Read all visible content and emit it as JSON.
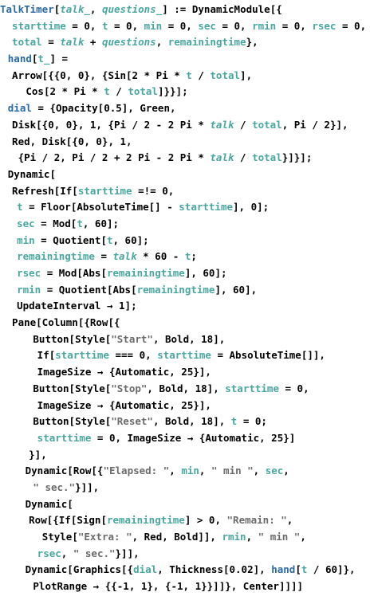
{
  "document": {
    "title": "TalkTimer notebook input",
    "lines": [
      {
        "indent": 0,
        "tokens": [
          [
            "f",
            "TalkTimer"
          ],
          [
            "p",
            "["
          ],
          [
            "i",
            "talk_"
          ],
          [
            "p",
            ", "
          ],
          [
            "i",
            "questions_"
          ],
          [
            "p",
            "] := DynamicModule[{"
          ]
        ]
      },
      {
        "indent": 2,
        "tokens": [
          [
            "g",
            "starttime"
          ],
          [
            "p",
            " = 0, "
          ],
          [
            "g",
            "t"
          ],
          [
            "p",
            " = 0, "
          ],
          [
            "g",
            "min"
          ],
          [
            "p",
            " = 0, "
          ],
          [
            "g",
            "sec"
          ],
          [
            "p",
            " = 0, "
          ],
          [
            "g",
            "rmin"
          ],
          [
            "p",
            " = 0, "
          ],
          [
            "g",
            "rsec"
          ],
          [
            "p",
            " = 0,"
          ]
        ]
      },
      {
        "indent": 2,
        "tokens": [
          [
            "g",
            "total"
          ],
          [
            "p",
            " = "
          ],
          [
            "i",
            "talk"
          ],
          [
            "p",
            " + "
          ],
          [
            "i",
            "questions"
          ],
          [
            "p",
            ", "
          ],
          [
            "g",
            "remainingtime"
          ],
          [
            "p",
            "},"
          ]
        ]
      },
      {
        "indent": 1.3,
        "tokens": [
          [
            "f",
            "hand"
          ],
          [
            "p",
            "["
          ],
          [
            "g",
            "t_"
          ],
          [
            "p",
            "] ="
          ]
        ]
      },
      {
        "indent": 2,
        "tokens": [
          [
            "p",
            "Arrow[{{0, 0}, {Sin[2 * Pi * "
          ],
          [
            "g",
            "t"
          ],
          [
            "p",
            " / "
          ],
          [
            "g",
            "total"
          ],
          [
            "p",
            "],"
          ]
        ]
      },
      {
        "indent": 4.3,
        "tokens": [
          [
            "p",
            "Cos[2 * Pi * "
          ],
          [
            "g",
            "t"
          ],
          [
            "p",
            " / "
          ],
          [
            "g",
            "total"
          ],
          [
            "p",
            "]}}];"
          ]
        ]
      },
      {
        "indent": 1.3,
        "tokens": [
          [
            "f",
            "dial"
          ],
          [
            "p",
            " = {Opacity[0.5], Green,"
          ]
        ]
      },
      {
        "indent": 2,
        "tokens": [
          [
            "p",
            "Disk[{0, 0}, 1, {Pi / 2 - 2 Pi * "
          ],
          [
            "i",
            "talk"
          ],
          [
            "p",
            " / "
          ],
          [
            "g",
            "total"
          ],
          [
            "p",
            ", Pi / 2}],"
          ]
        ]
      },
      {
        "indent": 2,
        "tokens": [
          [
            "p",
            "Red, Disk[{0, 0}, 1,"
          ]
        ]
      },
      {
        "indent": 3,
        "tokens": [
          [
            "p",
            "{Pi / 2, Pi / 2 + 2 Pi - 2 Pi * "
          ],
          [
            "i",
            "talk"
          ],
          [
            "p",
            " / "
          ],
          [
            "g",
            "total"
          ],
          [
            "p",
            "}]}];"
          ]
        ]
      },
      {
        "indent": 1.3,
        "tokens": [
          [
            "p",
            "Dynamic["
          ]
        ]
      },
      {
        "indent": 2,
        "tokens": [
          [
            "p",
            "Refresh[If["
          ],
          [
            "g",
            "starttime"
          ],
          [
            "p",
            " =!= 0,"
          ]
        ]
      },
      {
        "indent": 2.8,
        "tokens": [
          [
            "g",
            "t"
          ],
          [
            "p",
            " = Floor[AbsoluteTime[] - "
          ],
          [
            "g",
            "starttime"
          ],
          [
            "p",
            "], 0];"
          ]
        ]
      },
      {
        "indent": 2.8,
        "tokens": [
          [
            "g",
            "sec"
          ],
          [
            "p",
            " = Mod["
          ],
          [
            "g",
            "t"
          ],
          [
            "p",
            ", 60];"
          ]
        ]
      },
      {
        "indent": 2.8,
        "tokens": [
          [
            "g",
            "min"
          ],
          [
            "p",
            " = Quotient["
          ],
          [
            "g",
            "t"
          ],
          [
            "p",
            ", 60];"
          ]
        ]
      },
      {
        "indent": 2.8,
        "tokens": [
          [
            "g",
            "remainingtime"
          ],
          [
            "p",
            " = "
          ],
          [
            "i",
            "talk"
          ],
          [
            "p",
            " * 60 - "
          ],
          [
            "g",
            "t"
          ],
          [
            "p",
            ";"
          ]
        ]
      },
      {
        "indent": 2.8,
        "tokens": [
          [
            "g",
            "rsec"
          ],
          [
            "p",
            " = Mod[Abs["
          ],
          [
            "g",
            "remainingtime"
          ],
          [
            "p",
            "], 60];"
          ]
        ]
      },
      {
        "indent": 2.8,
        "tokens": [
          [
            "g",
            "rmin"
          ],
          [
            "p",
            " = Quotient[Abs["
          ],
          [
            "g",
            "remainingtime"
          ],
          [
            "p",
            "], 60],"
          ]
        ]
      },
      {
        "indent": 2.8,
        "tokens": [
          [
            "p",
            "UpdateInterval → 1];"
          ]
        ]
      },
      {
        "indent": 2,
        "tokens": [
          [
            "p",
            "Pane[Column[{Row[{"
          ]
        ]
      },
      {
        "indent": 5.5,
        "tokens": [
          [
            "p",
            "Button[Style["
          ],
          [
            "s",
            "\"Start\""
          ],
          [
            "p",
            ", Bold, 18],"
          ]
        ]
      },
      {
        "indent": 6.2,
        "tokens": [
          [
            "p",
            "If["
          ],
          [
            "g",
            "starttime"
          ],
          [
            "p",
            " === 0, "
          ],
          [
            "g",
            "starttime"
          ],
          [
            "p",
            " = AbsoluteTime[]],"
          ]
        ]
      },
      {
        "indent": 6.2,
        "tokens": [
          [
            "p",
            "ImageSize → {Automatic, 25}],"
          ]
        ]
      },
      {
        "indent": 5.5,
        "tokens": [
          [
            "p",
            "Button[Style["
          ],
          [
            "s",
            "\"Stop\""
          ],
          [
            "p",
            ", Bold, 18], "
          ],
          [
            "g",
            "starttime"
          ],
          [
            "p",
            " = 0,"
          ]
        ]
      },
      {
        "indent": 6.2,
        "tokens": [
          [
            "p",
            "ImageSize → {Automatic, 25}],"
          ]
        ]
      },
      {
        "indent": 5.5,
        "tokens": [
          [
            "p",
            "Button[Style["
          ],
          [
            "s",
            "\"Reset\""
          ],
          [
            "p",
            ", Bold, 18], "
          ],
          [
            "g",
            "t"
          ],
          [
            "p",
            " = 0;"
          ]
        ]
      },
      {
        "indent": 6.2,
        "tokens": [
          [
            "g",
            "starttime"
          ],
          [
            "p",
            " = 0, ImageSize → {Automatic, 25}]"
          ]
        ]
      },
      {
        "indent": 4.8,
        "tokens": [
          [
            "p",
            "}],"
          ]
        ]
      },
      {
        "indent": 4.2,
        "tokens": [
          [
            "p",
            "Dynamic[Row[{"
          ],
          [
            "s",
            "\"Elapsed: \""
          ],
          [
            "p",
            ", "
          ],
          [
            "g",
            "min"
          ],
          [
            "p",
            ", "
          ],
          [
            "s",
            "\" min \""
          ],
          [
            "p",
            ", "
          ],
          [
            "g",
            "sec"
          ],
          [
            "p",
            ","
          ]
        ]
      },
      {
        "indent": 5.5,
        "tokens": [
          [
            "s",
            "\" sec.\""
          ],
          [
            "p",
            "}]],"
          ]
        ]
      },
      {
        "indent": 4.2,
        "tokens": [
          [
            "p",
            "Dynamic["
          ]
        ]
      },
      {
        "indent": 4.8,
        "tokens": [
          [
            "p",
            "Row[{If[Sign["
          ],
          [
            "g",
            "remainingtime"
          ],
          [
            "p",
            "] > 0, "
          ],
          [
            "s",
            "\"Remain: \""
          ],
          [
            "p",
            ","
          ]
        ]
      },
      {
        "indent": 7,
        "tokens": [
          [
            "p",
            "Style["
          ],
          [
            "s",
            "\"Extra: \""
          ],
          [
            "p",
            ", Red, Bold]], "
          ],
          [
            "g",
            "rmin"
          ],
          [
            "p",
            ", "
          ],
          [
            "s",
            "\" min \""
          ],
          [
            "p",
            ","
          ]
        ]
      },
      {
        "indent": 6.2,
        "tokens": [
          [
            "g",
            "rsec"
          ],
          [
            "p",
            ", "
          ],
          [
            "s",
            "\" sec.\""
          ],
          [
            "p",
            "}]],"
          ]
        ]
      },
      {
        "indent": 4.2,
        "tokens": [
          [
            "p",
            "Dynamic[Graphics[{"
          ],
          [
            "g",
            "dial"
          ],
          [
            "p",
            ", Thickness[0.02], "
          ],
          [
            "f",
            "hand"
          ],
          [
            "p",
            "["
          ],
          [
            "g",
            "t"
          ],
          [
            "p",
            " / 60]},"
          ]
        ]
      },
      {
        "indent": 5.5,
        "tokens": [
          [
            "p",
            "PlotRange → {{-1, 1}, {-1, 1}}]]}, Center]]]]"
          ]
        ]
      }
    ]
  }
}
